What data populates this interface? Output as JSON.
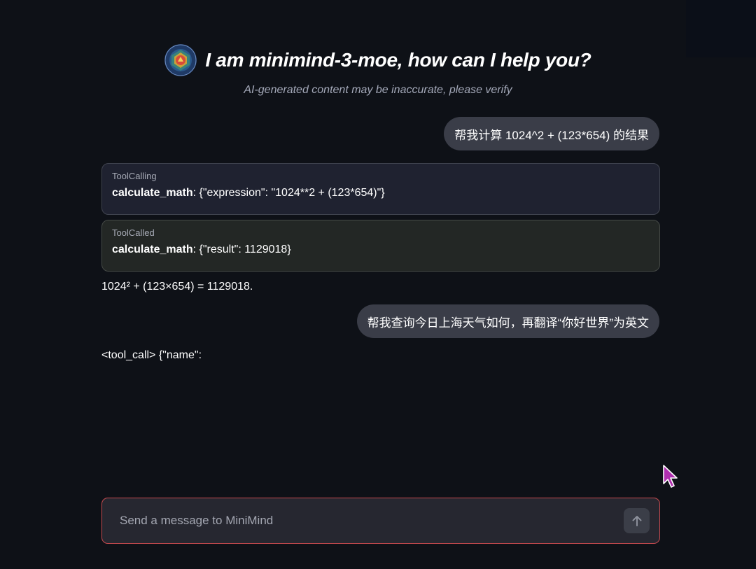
{
  "header": {
    "title": "I am minimind-3-moe, how can I help you?",
    "subtitle": "AI-generated content may be inaccurate, please verify"
  },
  "messages": {
    "user_1": "帮我计算 1024^2 + (123*654) 的结果",
    "tool_calling": {
      "kind": "ToolCalling",
      "function": "calculate_math",
      "args": ": {\"expression\": \"1024**2 + (123*654)\"}"
    },
    "tool_called": {
      "kind": "ToolCalled",
      "function": "calculate_math",
      "result": ": {\"result\": 1129018}"
    },
    "assistant_1": "1024² + (123×654) = 1129018.",
    "user_2": "帮我查询今日上海天气如何，再翻译“你好世界”为英文",
    "assistant_2_partial": "<tool_call> {\"name\":"
  },
  "input": {
    "placeholder": "Send a message to MiniMind",
    "value": ""
  },
  "icons": {
    "logo": "mandala-logo-icon",
    "send": "arrow-up-icon",
    "cursor": "mouse-pointer-icon"
  },
  "colors": {
    "background": "#0e1117",
    "input_border": "#c54a4f",
    "cursor": "#b02fb0"
  }
}
